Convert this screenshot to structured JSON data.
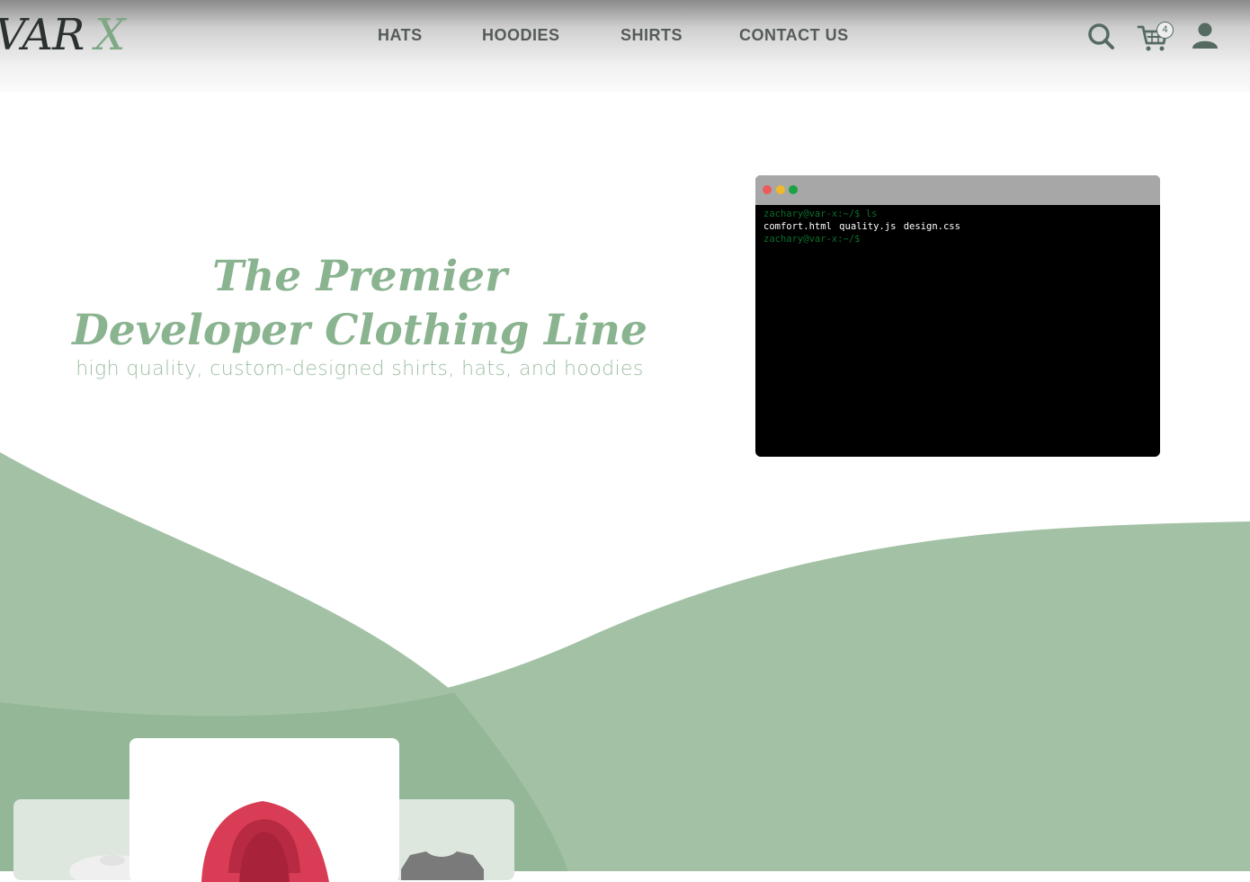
{
  "brand": {
    "name": "VAR",
    "mark": "X"
  },
  "nav": [
    {
      "label": "HATS"
    },
    {
      "label": "HOODIES"
    },
    {
      "label": "SHIRTS"
    },
    {
      "label": "CONTACT US"
    }
  ],
  "header_icons": {
    "search": "search-icon",
    "cart": "cart-icon",
    "account": "user-icon",
    "cart_count": "4"
  },
  "hero": {
    "title_line1": "The Premier",
    "title_line2": "Developer Clothing Line",
    "subtitle": "high quality, custom-designed shirts, hats, and hoodies"
  },
  "terminal": {
    "prompt1": "zachary@var-x:~/$ ls",
    "output": "comfort.html  quality.js  design.css",
    "prompt2": "zachary@var-x:~/$"
  },
  "colors": {
    "accent_green": "#a3c2a5",
    "title_green": "#8ab38f",
    "dark": "#2b3030"
  }
}
